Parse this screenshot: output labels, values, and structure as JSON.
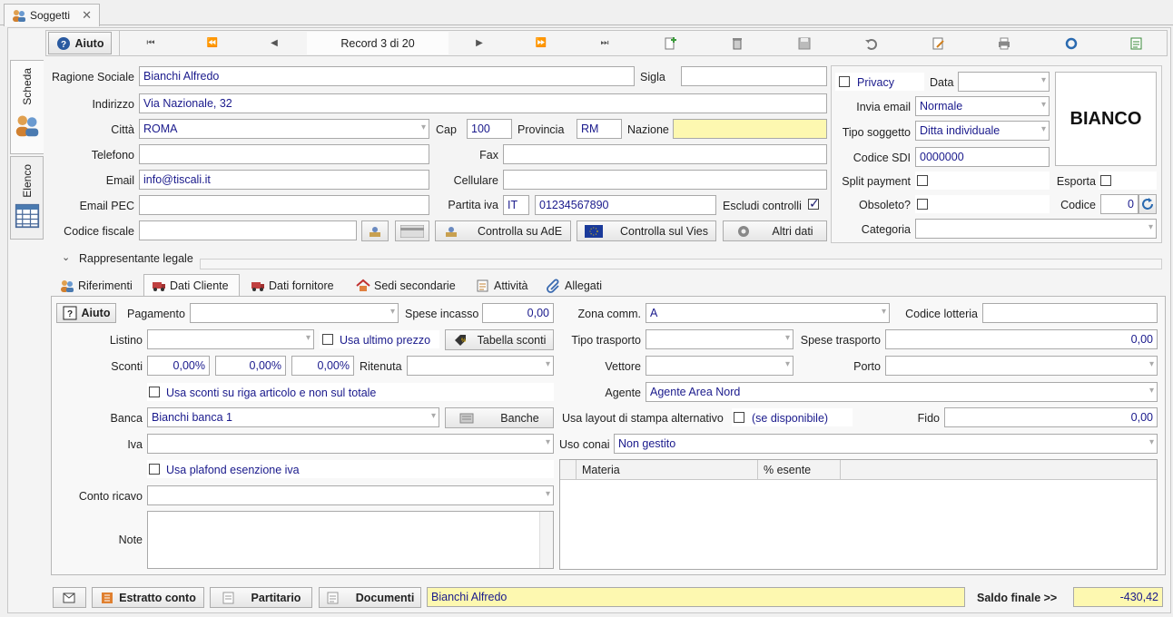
{
  "window": {
    "tab_title": "Soggetti"
  },
  "side_tabs": {
    "scheda": "Scheda",
    "elenco": "Elenco"
  },
  "toolbar": {
    "help_label": "Aiuto",
    "record_label": "Record 3 di 20"
  },
  "form": {
    "ragione_sociale_label": "Ragione Sociale",
    "ragione_sociale": "Bianchi Alfredo",
    "sigla_label": "Sigla",
    "sigla": "",
    "indirizzo_label": "Indirizzo",
    "indirizzo": "Via Nazionale, 32",
    "citta_label": "Città",
    "citta": "ROMA",
    "cap_label": "Cap",
    "cap": "100",
    "provincia_label": "Provincia",
    "provincia": "RM",
    "nazione_label": "Nazione",
    "nazione": "",
    "telefono_label": "Telefono",
    "telefono": "",
    "fax_label": "Fax",
    "fax": "",
    "email_label": "Email",
    "email": "info@tiscali.it",
    "cellulare_label": "Cellulare",
    "cellulare": "",
    "email_pec_label": "Email PEC",
    "email_pec": "",
    "partita_iva_label": "Partita iva",
    "partita_iva_prefix": "IT",
    "partita_iva": "01234567890",
    "escludi_controlli_label": "Escludi controlli",
    "codice_fiscale_label": "Codice fiscale",
    "codice_fiscale": "",
    "controlla_ade": "Controlla su AdE",
    "controlla_vies": "Controlla sul Vies",
    "altri_dati": "Altri dati"
  },
  "right_panel": {
    "privacy_label": "Privacy",
    "data_label": "Data",
    "data": "",
    "invia_email_label": "Invia email",
    "invia_email": "Normale",
    "tipo_soggetto_label": "Tipo soggetto",
    "tipo_soggetto": "Ditta individuale",
    "codice_sdi_label": "Codice SDI",
    "codice_sdi": "0000000",
    "split_payment_label": "Split payment",
    "esporta_label": "Esporta",
    "obsoleto_label": "Obsoleto?",
    "codice_label": "Codice",
    "codice": "0",
    "categoria_label": "Categoria",
    "categoria": "",
    "logo_text": "BIANCO"
  },
  "rappresentante": {
    "label": "Rappresentante legale"
  },
  "subtabs": [
    "Riferimenti",
    "Dati Cliente",
    "Dati fornitore",
    "Sedi secondarie",
    "Attività",
    "Allegati"
  ],
  "cliente": {
    "help_label": "Aiuto",
    "pagamento_label": "Pagamento",
    "pagamento": "",
    "spese_incasso_label": "Spese incasso",
    "spese_incasso": "0,00",
    "zona_comm_label": "Zona comm.",
    "zona_comm": "A",
    "codice_lotteria_label": "Codice lotteria",
    "codice_lotteria": "",
    "listino_label": "Listino",
    "listino": "",
    "usa_ultimo_prezzo_label": "Usa ultimo prezzo",
    "tabella_sconti": "Tabella sconti",
    "tipo_trasporto_label": "Tipo trasporto",
    "tipo_trasporto": "",
    "spese_trasporto_label": "Spese trasporto",
    "spese_trasporto": "0,00",
    "sconti_label": "Sconti",
    "sconto1": "0,00%",
    "sconto2": "0,00%",
    "sconto3": "0,00%",
    "ritenuta_label": "Ritenuta",
    "ritenuta": "",
    "vettore_label": "Vettore",
    "vettore": "",
    "porto_label": "Porto",
    "porto": "",
    "usa_sconti_riga_label": "Usa sconti su riga articolo e non sul totale",
    "agente_label": "Agente",
    "agente": "Agente Area Nord",
    "banca_label": "Banca",
    "banca": "Bianchi banca 1",
    "banche": "Banche",
    "layout_label": "Usa layout di stampa alternativo",
    "layout_note": "(se disponibile)",
    "fido_label": "Fido",
    "fido": "0,00",
    "iva_label": "Iva",
    "iva": "",
    "uso_conai_label": "Uso conai",
    "uso_conai": "Non gestito",
    "usa_plafond_label": "Usa plafond esenzione iva",
    "conto_ricavo_label": "Conto ricavo",
    "conto_ricavo": "",
    "note_label": "Note",
    "note": "",
    "grid_headers": [
      "Materia",
      "% esente"
    ]
  },
  "bottom": {
    "estratto_conto": "Estratto conto",
    "partitario": "Partitario",
    "documenti": "Documenti",
    "soggetto": "Bianchi Alfredo",
    "saldo_label": "Saldo finale >>",
    "saldo": "-430,42"
  },
  "colors": {
    "accent_text": "#1a1a8c",
    "highlight_field": "#fdf8b0"
  }
}
